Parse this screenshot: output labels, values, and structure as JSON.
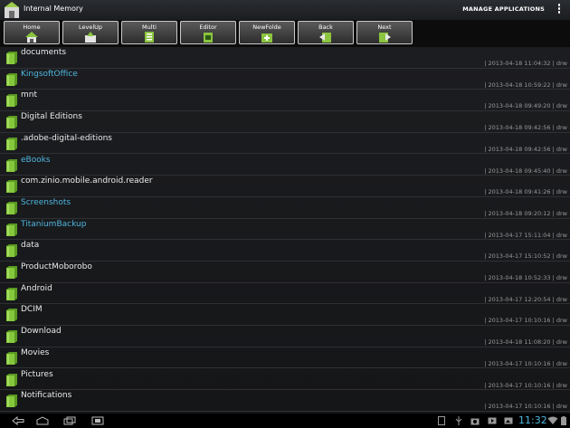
{
  "app": {
    "title": "Internal Memory",
    "manage_label": "MANAGE APPLICATIONS"
  },
  "toolbar": {
    "buttons": [
      {
        "label": "Home",
        "icon": "home-icon"
      },
      {
        "label": "LevelUp",
        "icon": "level-up-icon"
      },
      {
        "label": "Multi",
        "icon": "multi-select-icon"
      },
      {
        "label": "Editor",
        "icon": "editor-icon"
      },
      {
        "label": "NewFolde",
        "icon": "new-folder-icon"
      },
      {
        "label": "Back",
        "icon": "back-icon"
      },
      {
        "label": "Next",
        "icon": "next-icon"
      }
    ]
  },
  "files": [
    {
      "name": "documents",
      "meta": "| 2013-04-18 11:04:32 | drw",
      "link": false
    },
    {
      "name": "KingsoftOffice",
      "meta": "| 2013-04-18 10:59:22 | drw",
      "link": true
    },
    {
      "name": "mnt",
      "meta": "| 2013-04-18 09:49:20 | drw",
      "link": false
    },
    {
      "name": "Digital Editions",
      "meta": "| 2013-04-18 09:42:56 | drw",
      "link": false
    },
    {
      "name": ".adobe-digital-editions",
      "meta": "| 2013-04-18 09:42:56 | drw",
      "link": false
    },
    {
      "name": "eBooks",
      "meta": "| 2013-04-18 09:45:40 | drw",
      "link": true
    },
    {
      "name": "com.zinio.mobile.android.reader",
      "meta": "| 2013-04-18 09:41:26 | drw",
      "link": false
    },
    {
      "name": "Screenshots",
      "meta": "| 2013-04-18 09:20:12 | drw",
      "link": true
    },
    {
      "name": "TitaniumBackup",
      "meta": "| 2013-04-17 15:11:04 | drw",
      "link": true
    },
    {
      "name": "data",
      "meta": "| 2013-04-17 15:10:52 | drw",
      "link": false
    },
    {
      "name": "ProductMoborobo",
      "meta": "| 2013-04-18 10:52:33 | drw",
      "link": false
    },
    {
      "name": "Android",
      "meta": "| 2013-04-17 12:20:54 | drw",
      "link": false
    },
    {
      "name": "DCIM",
      "meta": "| 2013-04-17 10:10:16 | drw",
      "link": false
    },
    {
      "name": "Download",
      "meta": "| 2013-04-18 11:08:20 | drw",
      "link": false
    },
    {
      "name": "Movies",
      "meta": "| 2013-04-17 10:10:16 | drw",
      "link": false
    },
    {
      "name": "Pictures",
      "meta": "| 2013-04-17 10:10:16 | drw",
      "link": false
    },
    {
      "name": "Notifications",
      "meta": "| 2013-04-17 10:10:16 | drw",
      "link": false
    }
  ],
  "status_bar": {
    "time": "11:32"
  },
  "colors": {
    "accent": "#4fb6df",
    "folder_green": "#7ec23a"
  }
}
